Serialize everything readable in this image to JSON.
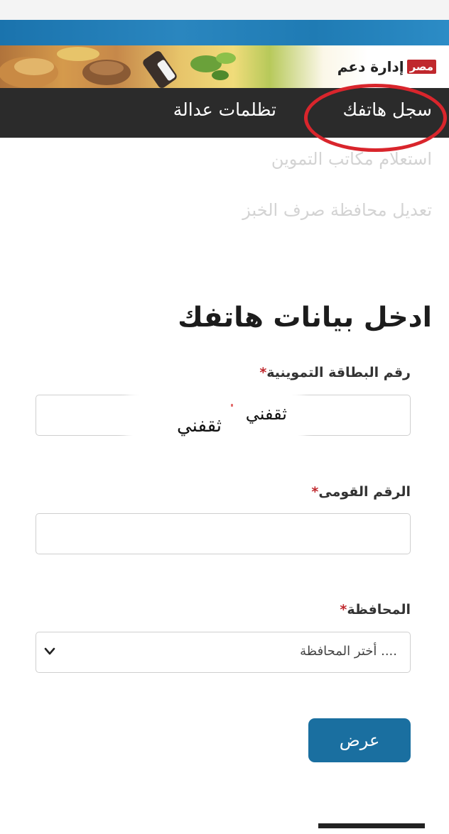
{
  "site": {
    "logo_text": "إدارة دعم",
    "logo_badge": "مصر"
  },
  "nav": {
    "items": [
      {
        "label": "سجل هاتفك",
        "highlighted": true
      },
      {
        "label": "تظلمات عدالة",
        "highlighted": false
      }
    ],
    "highlight_color": "#d9252c"
  },
  "links": [
    {
      "label": "استعلام مكاتب التموين"
    },
    {
      "label": "تعديل محافظة صرف الخبز"
    }
  ],
  "form": {
    "title": "ادخل بيانات هاتفك",
    "fields": [
      {
        "label": "رقم البطاقة التموينية",
        "required": true,
        "value": ""
      },
      {
        "label": "الرقم القومى",
        "required": true,
        "value": ""
      },
      {
        "label": "المحافظة",
        "required": true,
        "selected_value": ".... أختر المحافظة"
      }
    ],
    "submit_label": "عرض"
  },
  "watermark": {
    "line1": "ثقفني",
    "line2": "ثقفني"
  },
  "colors": {
    "navbar": "#2b2b2b",
    "accent_blue": "#1a6fa0",
    "required_star": "#c0282d"
  }
}
